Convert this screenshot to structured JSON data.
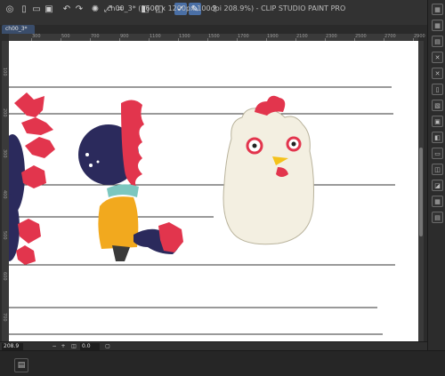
{
  "window": {
    "title": "ch00_3* (1600 x 1200px 100dpi 208.9%) - CLIP STUDIO PAINT PRO",
    "document_tab": "ch00_3*"
  },
  "toolbar": {
    "icons": [
      "app-menu-icon",
      "new-file-icon",
      "open-file-icon",
      "save-icon",
      "undo-icon",
      "redo-icon",
      "settings-icon",
      "transform-icon",
      "crop-icon",
      "fill-icon",
      "ruler-icon",
      "pen-pressure-icon",
      "pen-icon",
      "help-icon"
    ]
  },
  "ruler": {
    "top_labels": [
      "300",
      "500",
      "700",
      "900",
      "1100",
      "1300",
      "1500",
      "1700",
      "1900",
      "2100",
      "2300",
      "2500",
      "2700",
      "2900"
    ],
    "left_labels": [
      "100",
      "200",
      "300",
      "400",
      "500",
      "600",
      "700"
    ]
  },
  "statusbar": {
    "zoom": "208.9",
    "angle": "0.0",
    "buttons": [
      "−",
      "+",
      "◫",
      "▢"
    ]
  },
  "rightpanel": {
    "icons": [
      "panel-1-icon",
      "panel-2-icon",
      "panel-3-icon",
      "panel-4-icon",
      "panel-5-icon",
      "panel-6-icon",
      "panel-7-icon",
      "panel-8-icon",
      "panel-9-icon",
      "panel-10-icon",
      "panel-11-icon",
      "panel-12-icon",
      "panel-13-icon",
      "panel-14-icon"
    ]
  },
  "colors": {
    "line": "#333333",
    "navy": "#2b2a5c",
    "red": "#e2354d",
    "yellow": "#f2a91e",
    "teal": "#7cc7bf",
    "chicken": "#f3efe1",
    "beak": "#f4c21b"
  }
}
